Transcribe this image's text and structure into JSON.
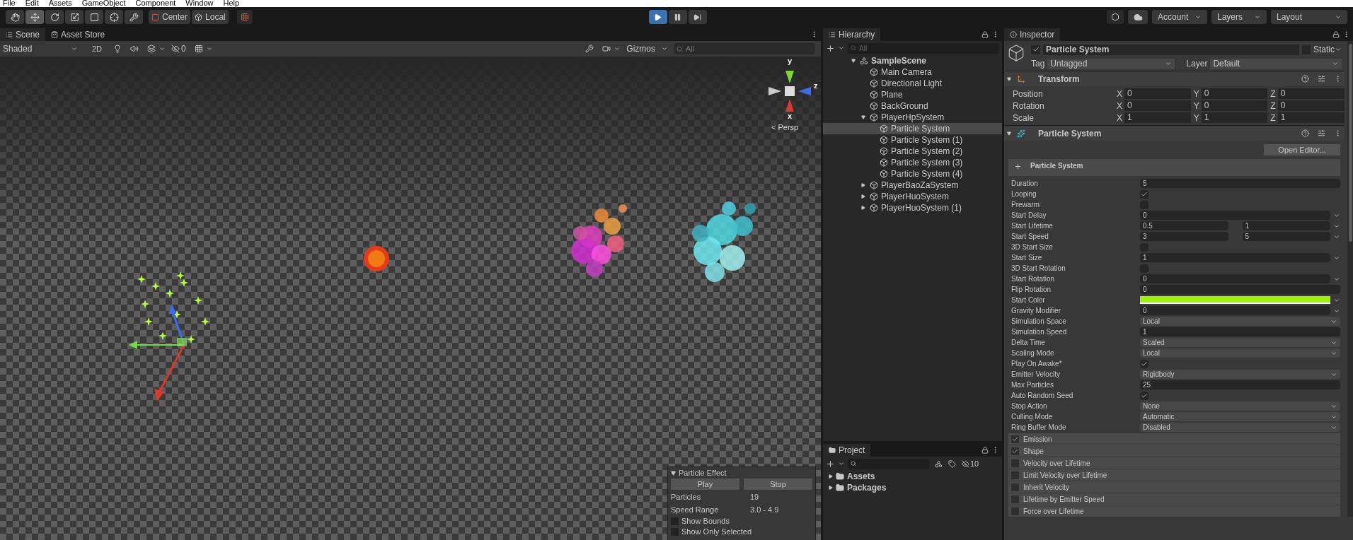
{
  "menu": [
    "File",
    "Edit",
    "Assets",
    "GameObject",
    "Component",
    "Window",
    "Help"
  ],
  "toolbar": {
    "tools": [
      {
        "kind": "hand",
        "selected": false
      },
      {
        "kind": "move",
        "selected": true
      },
      {
        "kind": "rotate",
        "selected": false
      },
      {
        "kind": "scale",
        "selected": false
      },
      {
        "kind": "rect",
        "selected": false
      },
      {
        "kind": "transform",
        "selected": false
      },
      {
        "kind": "custom",
        "selected": false
      }
    ],
    "pivot": "Center",
    "space": "Local",
    "playback": [
      {
        "kind": "play",
        "on": true
      },
      {
        "kind": "pause",
        "on": false
      },
      {
        "kind": "step",
        "on": false
      }
    ],
    "account": "Account",
    "layers": "Layers",
    "layout": "Layout"
  },
  "scene": {
    "tabs": [
      {
        "label": "Scene",
        "kind": "scene",
        "selected": true
      },
      {
        "label": "Asset Store",
        "kind": "store",
        "selected": false
      }
    ],
    "shading": "Shaded",
    "mode_2d": "2D",
    "hidden_count": "0",
    "gizmos": "Gizmos",
    "search": {
      "placeholder": "All"
    },
    "gizmo_labels": [
      "y",
      "z",
      "x"
    ],
    "view_label": "< Persp",
    "particle_effect": {
      "title": "Particle Effect",
      "buttons": [
        "Play",
        "Stop"
      ],
      "stats": [
        {
          "label": "Particles",
          "value": "19"
        },
        {
          "label": "Speed Range",
          "value": "3.0 - 4.9"
        }
      ],
      "options": [
        {
          "label": "Show Bounds",
          "checked": false
        },
        {
          "label": "Show Only Selected",
          "checked": false
        }
      ]
    }
  },
  "hierarchy": {
    "title": "Hierarchy",
    "search": {
      "placeholder": "All"
    },
    "items": [
      {
        "name": "SampleScene",
        "kind": "scene",
        "expanded": true,
        "selected": false,
        "children": [
          {
            "name": "Main Camera",
            "kind": "object",
            "selected": false
          },
          {
            "name": "Directional Light",
            "kind": "object",
            "selected": false
          },
          {
            "name": "Plane",
            "kind": "object",
            "selected": false
          },
          {
            "name": "BackGround",
            "kind": "object",
            "selected": false
          },
          {
            "name": "PlayerHpSystem",
            "kind": "object",
            "expanded": true,
            "selected": false,
            "children": [
              {
                "name": "Particle System",
                "kind": "object",
                "selected": true
              },
              {
                "name": "Particle System (1)",
                "kind": "object",
                "selected": false
              },
              {
                "name": "Particle System (2)",
                "kind": "object",
                "selected": false
              },
              {
                "name": "Particle System (3)",
                "kind": "object",
                "selected": false
              },
              {
                "name": "Particle System (4)",
                "kind": "object",
                "selected": false
              }
            ]
          },
          {
            "name": "PlayerBaoZaSystem",
            "kind": "object",
            "expanded": false,
            "selected": false
          },
          {
            "name": "PlayerHuoSystem",
            "kind": "object",
            "expanded": false,
            "selected": false
          },
          {
            "name": "PlayerHuoSystem (1)",
            "kind": "object",
            "expanded": false,
            "selected": false
          }
        ]
      }
    ]
  },
  "project": {
    "title": "Project",
    "hidden_count": "10",
    "folders": [
      {
        "name": "Assets",
        "expanded": false
      },
      {
        "name": "Packages",
        "expanded": false
      }
    ]
  },
  "inspector": {
    "title": "Inspector",
    "object": {
      "active": true,
      "name": "Particle System",
      "static": false,
      "static_label": "Static",
      "tag_label": "Tag",
      "tag": "Untagged",
      "layer_label": "Layer",
      "layer": "Default"
    },
    "transform": {
      "title": "Transform",
      "expanded": true,
      "rows": [
        {
          "label": "Position",
          "values": [
            {
              "axis": "X",
              "value": "0"
            },
            {
              "axis": "Y",
              "value": "0"
            },
            {
              "axis": "Z",
              "value": "0"
            }
          ]
        },
        {
          "label": "Rotation",
          "values": [
            {
              "axis": "X",
              "value": "0"
            },
            {
              "axis": "Y",
              "value": "0"
            },
            {
              "axis": "Z",
              "value": "0"
            }
          ]
        },
        {
          "label": "Scale",
          "values": [
            {
              "axis": "X",
              "value": "1"
            },
            {
              "axis": "Y",
              "value": "1"
            },
            {
              "axis": "Z",
              "value": "1"
            }
          ]
        }
      ]
    },
    "particle_system": {
      "title": "Particle System",
      "expanded": true,
      "open_editor": "Open Editor...",
      "main_title": "Particle System",
      "properties": [
        {
          "label": "Duration",
          "kind": "number",
          "value": "5"
        },
        {
          "label": "Looping",
          "kind": "checkbox",
          "checked": true
        },
        {
          "label": "Prewarm",
          "kind": "checkbox",
          "checked": false
        },
        {
          "label": "Start Delay",
          "kind": "curve",
          "value": "0"
        },
        {
          "label": "Start Lifetime",
          "kind": "range",
          "values": [
            "0.5",
            "1"
          ]
        },
        {
          "label": "Start Speed",
          "kind": "range",
          "values": [
            "3",
            "5"
          ]
        },
        {
          "label": "3D Start Size",
          "kind": "checkbox",
          "checked": false
        },
        {
          "label": "Start Size",
          "kind": "curve",
          "value": "1"
        },
        {
          "label": "3D Start Rotation",
          "kind": "checkbox",
          "checked": false
        },
        {
          "label": "Start Rotation",
          "kind": "curve",
          "value": "0"
        },
        {
          "label": "Flip Rotation",
          "kind": "number",
          "value": "0"
        },
        {
          "label": "Start Color",
          "kind": "color",
          "color": "#99f500"
        },
        {
          "label": "Gravity Modifier",
          "kind": "curve",
          "value": "0"
        },
        {
          "label": "Simulation Space",
          "kind": "dropdown",
          "value": "Local"
        },
        {
          "label": "Simulation Speed",
          "kind": "number",
          "value": "1"
        },
        {
          "label": "Delta Time",
          "kind": "dropdown",
          "value": "Scaled"
        },
        {
          "label": "Scaling Mode",
          "kind": "dropdown",
          "value": "Local"
        },
        {
          "label": "Play On Awake*",
          "kind": "checkbox",
          "checked": true
        },
        {
          "label": "Emitter Velocity",
          "kind": "dropdown",
          "value": "Rigidbody"
        },
        {
          "label": "Max Particles",
          "kind": "number",
          "value": "25"
        },
        {
          "label": "Auto Random Seed",
          "kind": "checkbox",
          "checked": true
        },
        {
          "label": "Stop Action",
          "kind": "dropdown",
          "value": "None"
        },
        {
          "label": "Culling Mode",
          "kind": "dropdown",
          "value": "Automatic"
        },
        {
          "label": "Ring Buffer Mode",
          "kind": "dropdown",
          "value": "Disabled"
        }
      ],
      "modules": [
        {
          "label": "Emission",
          "checked": true
        },
        {
          "label": "Shape",
          "checked": true
        },
        {
          "label": "Velocity over Lifetime",
          "checked": false
        },
        {
          "label": "Limit Velocity over Lifetime",
          "checked": false
        },
        {
          "label": "Inherit Velocity",
          "checked": false
        },
        {
          "label": "Lifetime by Emitter Speed",
          "checked": false
        },
        {
          "label": "Force over Lifetime",
          "checked": false
        }
      ]
    }
  }
}
